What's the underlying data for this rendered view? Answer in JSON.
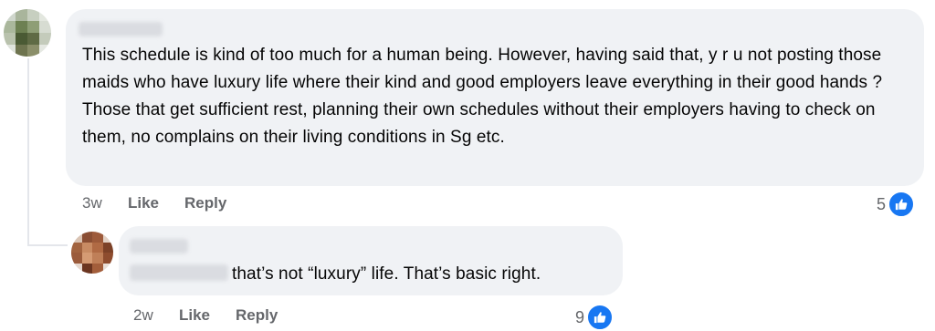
{
  "comments": {
    "main": {
      "text": "This schedule is kind of too much for a human being. However, having said that, y r u not posting those maids who have luxury life where their kind and good employers leave everything in their good hands ? Those that get sufficient rest, planning their own schedules without their employers having to check on them, no complains on their living conditions in Sg etc.",
      "time": "3w",
      "like_label": "Like",
      "reply_label": "Reply",
      "reaction_count": "5"
    },
    "reply": {
      "text": "that’s not “luxury” life. That’s basic right.",
      "time": "2w",
      "like_label": "Like",
      "reply_label": "Reply",
      "reaction_count": "9"
    }
  },
  "icons": {
    "reaction": "thumbs-up-icon",
    "avatar": "avatar"
  },
  "colors": {
    "bubble": "#f0f2f5",
    "meta_text": "#65676b",
    "like_blue": "#1877f2",
    "body_text": "#050505"
  }
}
